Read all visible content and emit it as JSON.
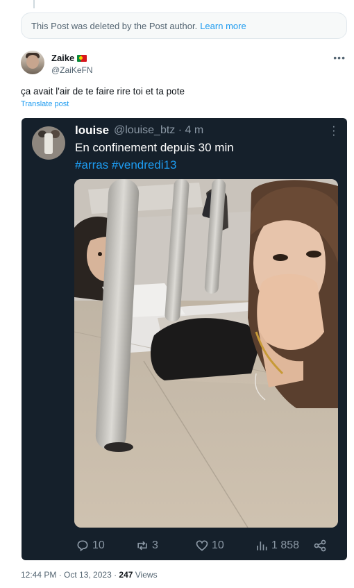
{
  "deleted_notice": {
    "text": "This Post was deleted by the Post author.",
    "link": "Learn more"
  },
  "author": {
    "name": "Zaike",
    "flag": "portugal-flag-icon",
    "handle": "@ZaiKeFN"
  },
  "post": {
    "text": "ça avait l'air de te faire rire toi et ta pote",
    "translate": "Translate post"
  },
  "quoted": {
    "name": "louise",
    "meta": "@louise_btz · 4 m",
    "text": "En confinement depuis 30 min",
    "tags": [
      "#arras",
      "#vendredi13"
    ],
    "actions": {
      "replies": "10",
      "reposts": "3",
      "likes": "10",
      "views": "1 858"
    }
  },
  "footer": {
    "time": "12:44 PM · Oct 13, 2023 · ",
    "views_count": "247",
    "views_label": " Views"
  },
  "colors": {
    "accent": "#1d9bf0",
    "dark_bg": "#15202b",
    "muted": "#536471"
  }
}
